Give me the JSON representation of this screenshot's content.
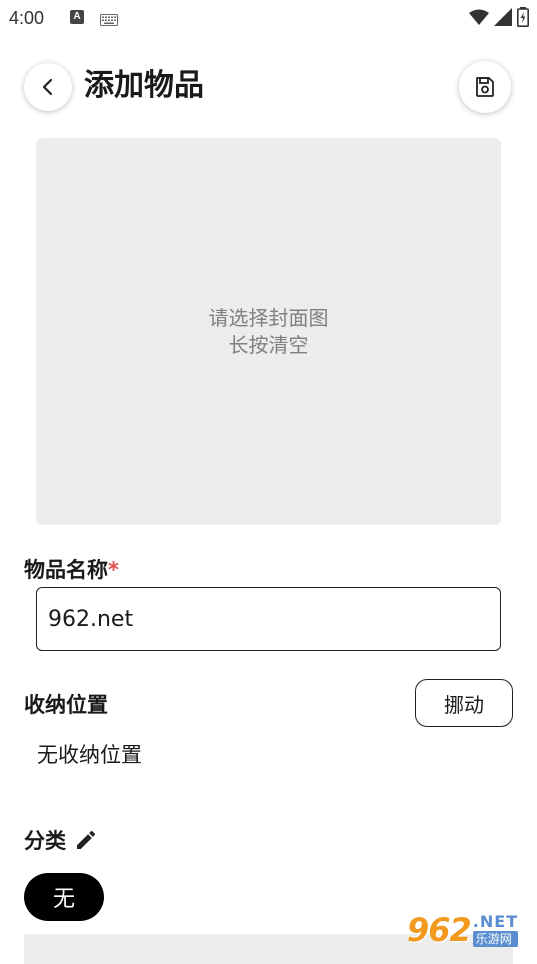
{
  "status_bar": {
    "time": "4:00",
    "notification_letter": "A"
  },
  "header": {
    "title": "添加物品"
  },
  "cover": {
    "line1": "请选择封面图",
    "line2": "长按清空"
  },
  "name_field": {
    "label": "物品名称",
    "required_mark": "*",
    "value": "962.net"
  },
  "storage": {
    "label": "收纳位置",
    "move_label": "挪动",
    "value": "无收纳位置"
  },
  "category": {
    "label": "分类",
    "chip": "无"
  },
  "watermark": {
    "number": "962",
    "domain": ".NET",
    "site": "乐游网"
  }
}
